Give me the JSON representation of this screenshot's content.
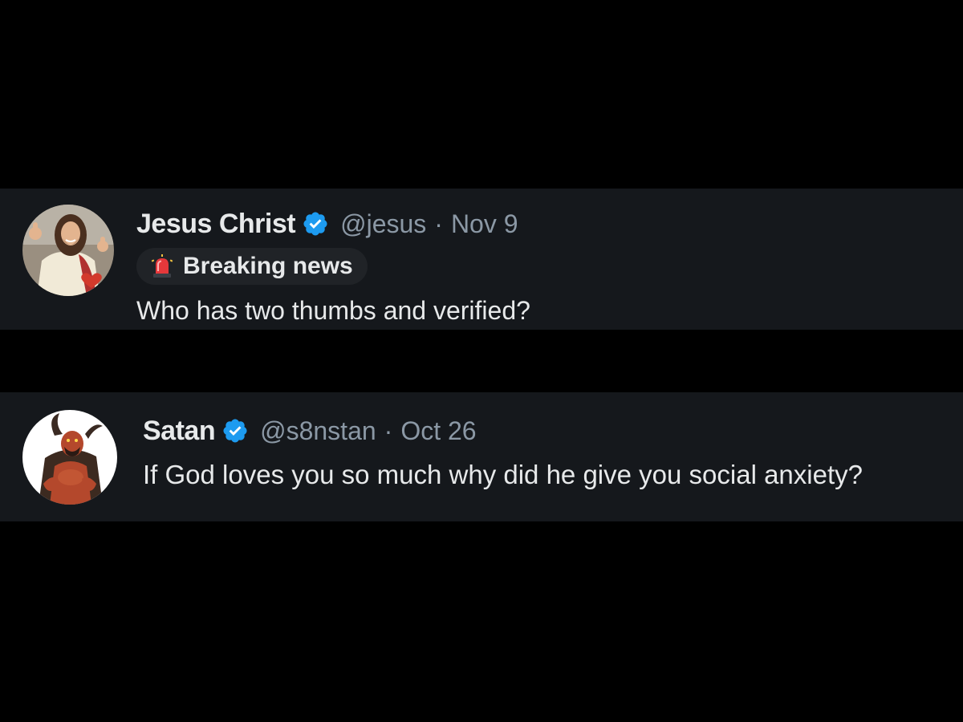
{
  "tweets": [
    {
      "display_name": "Jesus Christ",
      "verified_icon": "verified-badge-icon",
      "handle": "@jesus",
      "separator": "·",
      "date": "Nov 9",
      "badge": {
        "icon": "siren-icon",
        "label": "Breaking news"
      },
      "text": "Who has two thumbs and verified?"
    },
    {
      "display_name": "Satan",
      "verified_icon": "verified-badge-icon",
      "handle": "@s8nstan",
      "separator": "·",
      "date": "Oct 26",
      "text": "If God loves you so much why did he give you social anxiety?"
    }
  ],
  "colors": {
    "page_background": "#000000",
    "tweet_background": "#15181c",
    "primary_text": "#e7e9ea",
    "secondary_text": "#8b98a5",
    "verified_blue": "#1d9bf0",
    "badge_background": "#202327"
  }
}
